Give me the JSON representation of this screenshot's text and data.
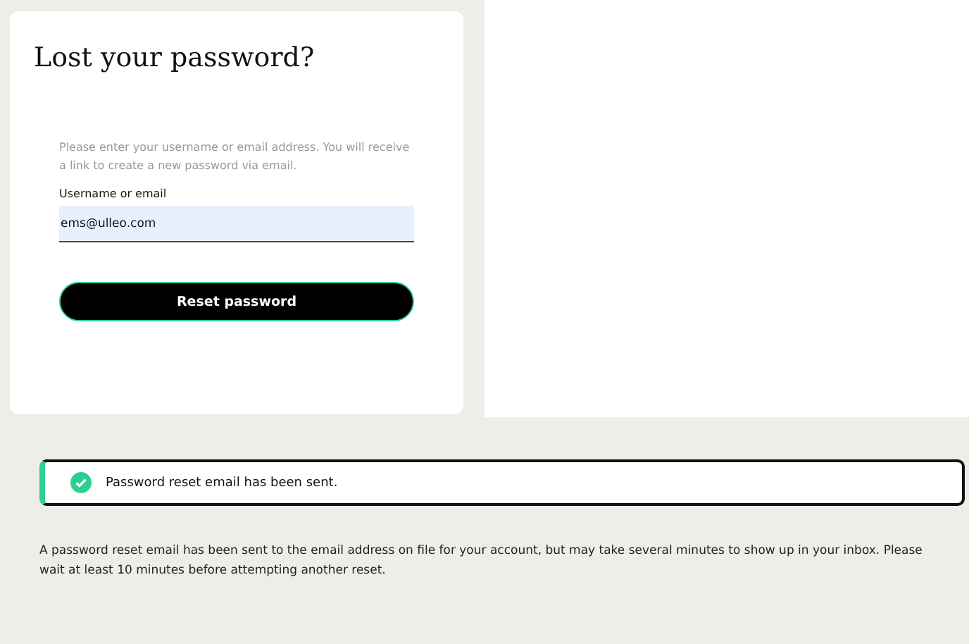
{
  "card": {
    "title": "Lost your password?",
    "instructions": "Please enter your username or email address. You will receive a link to create a new password via email.",
    "field": {
      "label": "Username or email",
      "value": "ems@ulleo.com"
    },
    "button": "Reset password"
  },
  "notice": {
    "kind": "success",
    "message": "Password reset email has been sent."
  },
  "info": "A password reset email has been sent to the email address on file for your account, but may take several minutes to show up in your inbox. Please wait at least 10 minutes before attempting another reset."
}
